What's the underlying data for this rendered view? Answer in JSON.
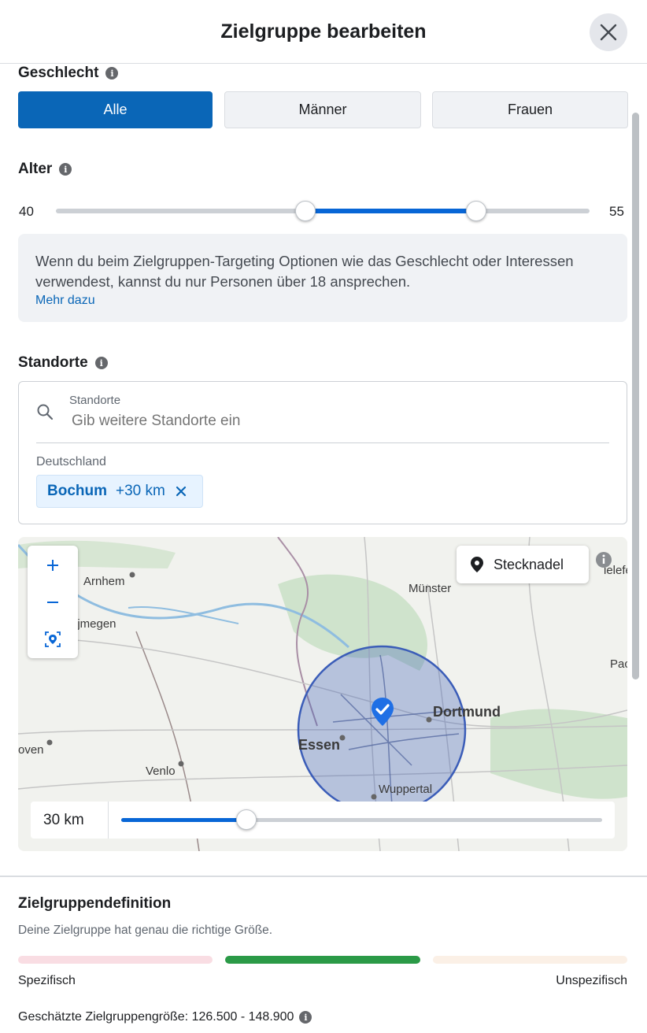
{
  "header": {
    "title": "Zielgruppe bearbeiten",
    "close_icon": "close-icon"
  },
  "gender": {
    "label": "Geschlecht",
    "options": [
      "Alle",
      "Männer",
      "Frauen"
    ],
    "selected": "Alle"
  },
  "age": {
    "label": "Alter",
    "min": "40",
    "max": "55",
    "range_min": 18,
    "range_max": 65
  },
  "notice": {
    "text": "Wenn du beim Zielgruppen-Targeting Optionen wie das Geschlecht oder Interessen verwendest, kannst du nur Personen über 18 ansprechen.",
    "link": "Mehr dazu"
  },
  "locations": {
    "label": "Standorte",
    "search_label": "Standorte",
    "search_placeholder": "Gib weitere Standorte ein",
    "country": "Deutschland",
    "tag_city": "Bochum",
    "tag_radius": "+30 km"
  },
  "map": {
    "cities": [
      "Arnhem",
      "Nijmegen",
      "Münster",
      "Dortmund",
      "Essen",
      "Venlo",
      "Wuppertal",
      "Eindhoven",
      "Bielefeld",
      "Paderborn"
    ],
    "city_labels": {
      "arnhem": "Arnhem",
      "nijmegen": "ijmegen",
      "muenster": "Münster",
      "dortmund": "Dortmund",
      "essen": "Essen",
      "venlo": "Venlo",
      "wuppertal": "Wuppertal",
      "eindhoven": "oven",
      "bielefeld": "ielefeld",
      "paderborn": "Pac"
    },
    "pin_label": "Stecknadel",
    "radius_value": "30 km",
    "radius_fraction": 0.26
  },
  "definition": {
    "title": "Zielgruppendefinition",
    "status": "Deine Zielgruppe hat genau die richtige Größe.",
    "left_label": "Spezifisch",
    "right_label": "Unspezifisch",
    "estimate": "Geschätzte Zielgruppengröße: 126.500 - 148.900"
  },
  "colors": {
    "primary": "#0a66b7",
    "good": "#2b9a47",
    "map_circle": "#3b5db8"
  }
}
